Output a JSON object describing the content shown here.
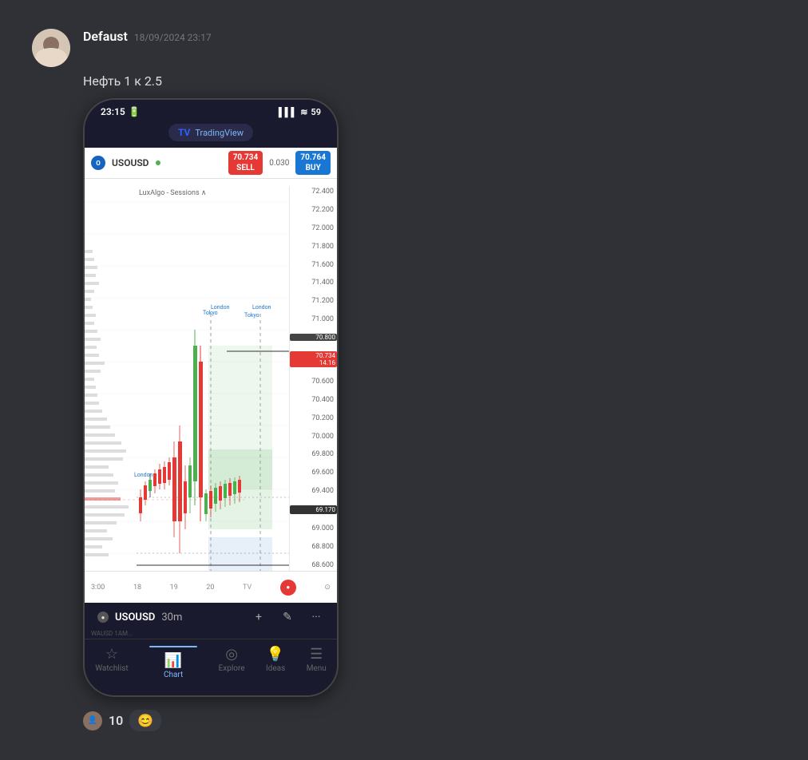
{
  "post": {
    "author": "Defaust",
    "timestamp": "18/09/2024 23:17",
    "message": "Нефть 1 к 2.5",
    "reactions": {
      "count": "10",
      "emoji": "😊"
    }
  },
  "phone": {
    "status_bar": {
      "time": "23:15",
      "signal_bars": "▌▌▌",
      "wifi": "WiFi",
      "battery": "59"
    },
    "tradingview_label": "TradingView",
    "chart": {
      "symbol": "USOUSD",
      "sell_label": "SELL",
      "buy_label": "BUY",
      "sell_price": "70.734",
      "buy_price": "70.764",
      "spread": "0.030",
      "current_price": "70.734",
      "indicator": "14.16",
      "price_levels": [
        "72.400",
        "72.200",
        "72.000",
        "71.800",
        "71.600",
        "71.400",
        "71.200",
        "71.000",
        "70.800",
        "70.600",
        "70.400",
        "70.200",
        "70.000",
        "69.800",
        "69.600",
        "69.400",
        "69.000",
        "68.800",
        "68.600"
      ],
      "highlighted_price": "69.170",
      "lux_algo_label": "LuxAlgo - Sessions",
      "time_labels": [
        "3:00",
        "18",
        "19",
        "20"
      ],
      "session_labels": [
        "London",
        "Tokyo",
        "London",
        "Tokyo"
      ]
    },
    "bottom_controls": {
      "symbol": "USOUSD",
      "timeframe": "30m"
    },
    "tabs": [
      {
        "label": "Watchlist",
        "active": false,
        "icon": "☆"
      },
      {
        "label": "Chart",
        "active": true,
        "icon": "📊"
      },
      {
        "label": "Explore",
        "active": false,
        "icon": "◎"
      },
      {
        "label": "Ideas",
        "active": false,
        "icon": "💡"
      },
      {
        "label": "Menu",
        "active": false,
        "icon": "☰"
      }
    ]
  }
}
